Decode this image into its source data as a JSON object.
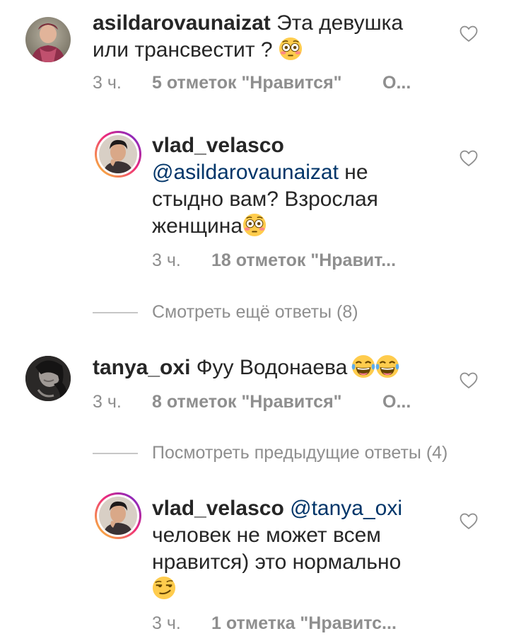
{
  "comments": [
    {
      "username": "asildarovaunaizat",
      "text_line1": "Эта девушка",
      "text_line2": "или трансвестит ?",
      "time": "3 ч.",
      "likes": "5 отметок \"Нравится\"",
      "reply": "О..."
    },
    {
      "username": "vlad_velasco",
      "mention": "@asildarovaunaizat",
      "text_line1_rest": " не",
      "text_line2": "стыдно вам? Взрослая",
      "text_line3": "женщина",
      "time": "3 ч.",
      "likes": "18 отметок \"Нравит..."
    },
    {
      "username": "tanya_oxi",
      "text": "Фуу Водонаева",
      "time": "3 ч.",
      "likes": "8 отметок \"Нравится\"",
      "reply": "О..."
    },
    {
      "username": "vlad_velasco",
      "mention": "@tanya_oxi",
      "text_line2": "человек не может всем",
      "text_line3": "нравится) это нормально",
      "time": "3 ч.",
      "likes": "1 отметка \"Нравитс..."
    }
  ],
  "view_more_replies": "Смотреть ещё ответы (8)",
  "view_previous_replies": "Посмотреть предыдущие ответы (4)",
  "icons": {
    "heart": "heart-outline-icon",
    "emoji_flushed": "flushed-face-emoji",
    "emoji_laughing": "tears-of-joy-emoji",
    "emoji_smirk": "smirking-face-emoji"
  },
  "colors": {
    "text": "#262626",
    "meta": "#8e8e8e",
    "mention": "#003569"
  }
}
